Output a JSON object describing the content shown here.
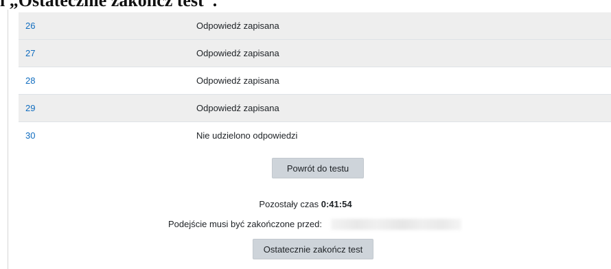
{
  "heading": "Ostatecznie zakończ test",
  "heading_visible_prefix": "i „",
  "heading_visible_suffix": "”.",
  "summary_rows": [
    {
      "question": "26",
      "status": "Odpowiedź zapisana",
      "shaded": true
    },
    {
      "question": "27",
      "status": "Odpowiedź zapisana",
      "shaded": true
    },
    {
      "question": "28",
      "status": "Odpowiedź zapisana",
      "shaded": false
    },
    {
      "question": "29",
      "status": "Odpowiedź zapisana",
      "shaded": true
    },
    {
      "question": "30",
      "status": "Nie udzielono odpowiedzi",
      "shaded": false
    }
  ],
  "buttons": {
    "return_label": "Powrót do testu",
    "finish_label": "Ostatecznie zakończ test"
  },
  "timer": {
    "label": "Pozostały czas",
    "value": "0:41:54"
  },
  "deadline": {
    "label": "Podejście musi być zakończone przed:"
  },
  "colors": {
    "link": "#0f6cbf",
    "row_shade": "#eeeeee",
    "button_bg": "#ced4da"
  }
}
